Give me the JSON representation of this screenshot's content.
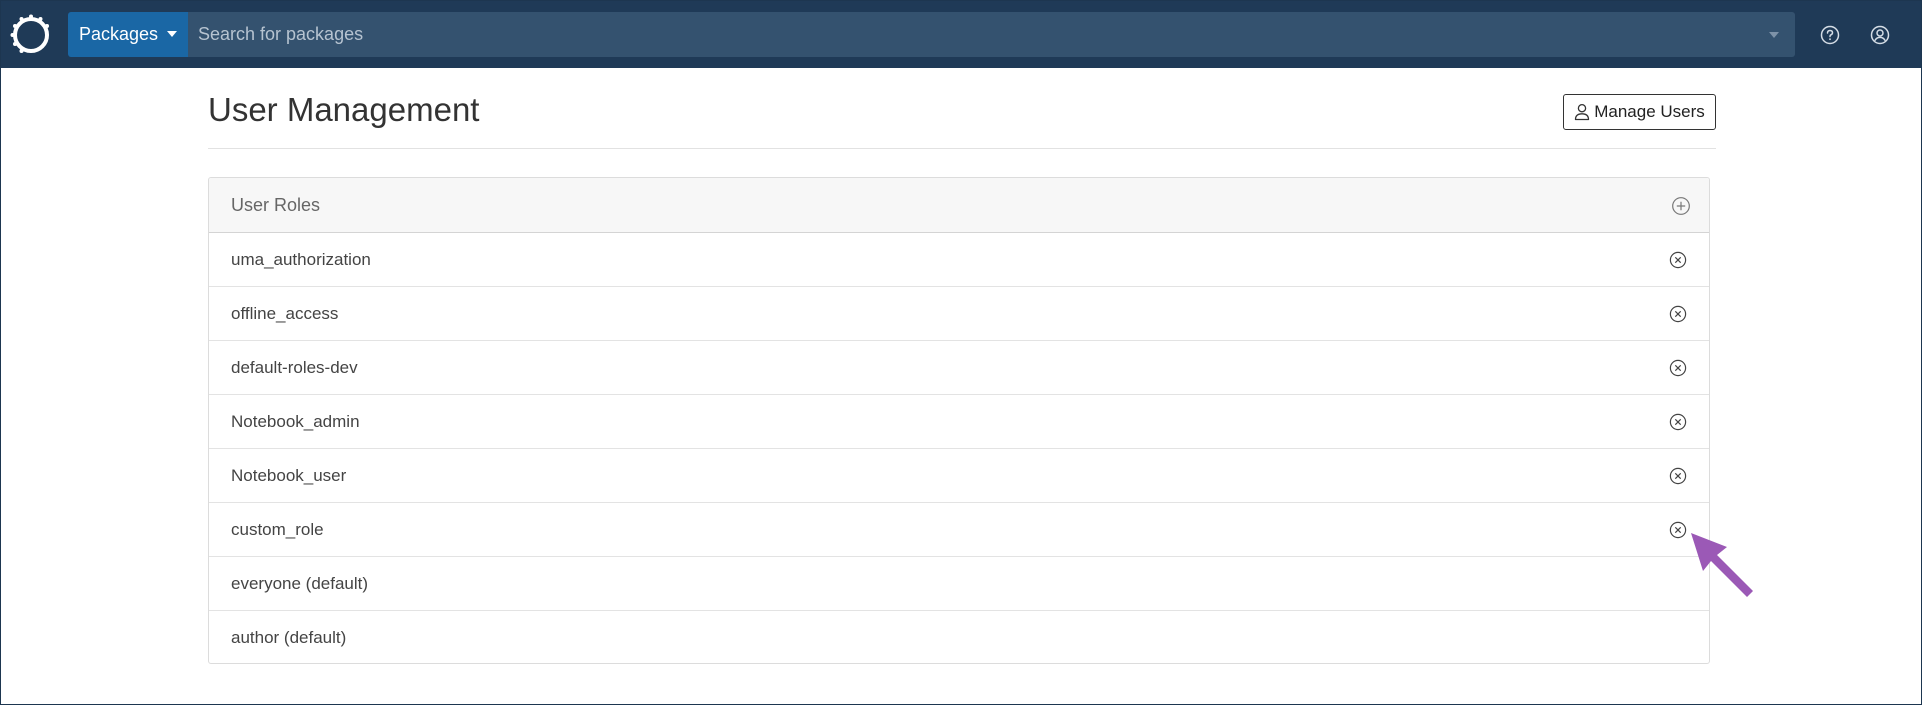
{
  "nav": {
    "packages_label": "Packages",
    "search_placeholder": "Search for packages",
    "icons": [
      "logo-icon",
      "help-icon",
      "account-icon"
    ]
  },
  "page": {
    "title": "User Management",
    "manage_users_label": "Manage Users"
  },
  "roles": {
    "header": "User Roles",
    "items": [
      {
        "name": "uma_authorization",
        "removable": true
      },
      {
        "name": "offline_access",
        "removable": true
      },
      {
        "name": "default-roles-dev",
        "removable": true
      },
      {
        "name": "Notebook_admin",
        "removable": true
      },
      {
        "name": "Notebook_user",
        "removable": true
      },
      {
        "name": "custom_role",
        "removable": true
      },
      {
        "name": "everyone (default)",
        "removable": false
      },
      {
        "name": "author (default)",
        "removable": false
      }
    ]
  },
  "colors": {
    "navbar": "#1f3a57",
    "packages_button": "#1a67a5",
    "search_field": "#34526f",
    "annotation_arrow": "#9b59b6"
  }
}
